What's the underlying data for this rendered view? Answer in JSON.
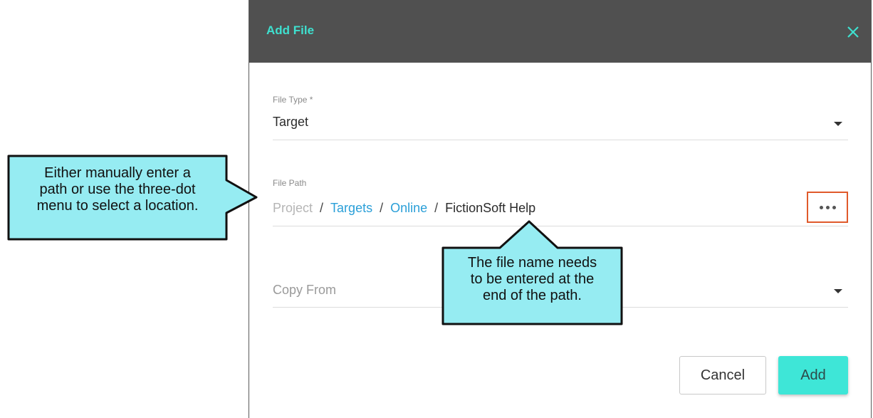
{
  "dialog": {
    "title": "Add File",
    "close_icon": "close-icon"
  },
  "file_type": {
    "label": "File Type *",
    "value": "Target",
    "dropdown_icon": "chevron-down-icon"
  },
  "file_path": {
    "label": "File Path",
    "crumbs": {
      "root": "Project",
      "sep": "/",
      "folder1": "Targets",
      "folder2": "Online",
      "file": "FictionSoft Help"
    },
    "menu_icon": "more-horizontal-icon"
  },
  "copy_from": {
    "placeholder": "Copy From",
    "dropdown_icon": "chevron-down-icon"
  },
  "buttons": {
    "cancel": "Cancel",
    "add": "Add"
  },
  "callouts": {
    "left": [
      "Either manually enter a",
      "path or use the three-dot",
      "menu to select a location."
    ],
    "bottom": [
      "The file name needs",
      "to be entered at the",
      "end of the path."
    ]
  },
  "colors": {
    "header_bg": "#505050",
    "accent": "#3ee0cf",
    "link": "#2a9fd8",
    "highlight_border": "#e05a2b",
    "callout_fill": "#96ecf2"
  }
}
